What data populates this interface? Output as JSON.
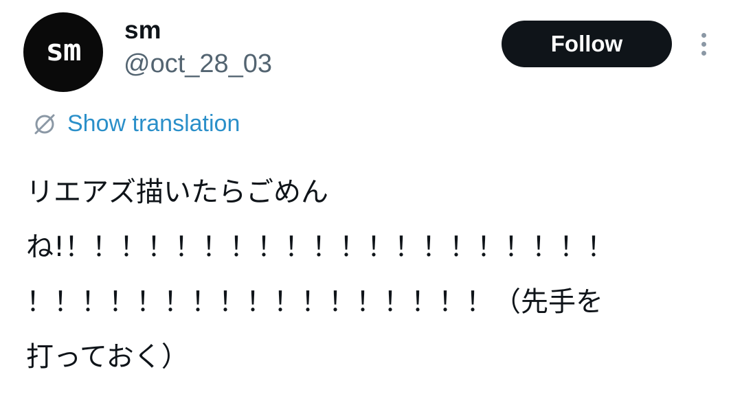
{
  "author": {
    "avatar_text": "sm",
    "display_name": "sm",
    "handle": "@oct_28_03"
  },
  "actions": {
    "follow_label": "Follow",
    "more_icon": "more-dots-vertical-icon"
  },
  "translation": {
    "icon": "translate-globe-icon",
    "label": "Show translation"
  },
  "tweet": {
    "text": "リエアズ描いたらごめん\nね!！！！！！！！！！！！！！！！！！！！！\n！！！！！！！！！！！！！！！！！（先手を\n打っておく）"
  },
  "colors": {
    "text_primary": "#0f1419",
    "text_secondary": "#536471",
    "link": "#2a8fc9",
    "follow_bg": "#0f1419"
  }
}
